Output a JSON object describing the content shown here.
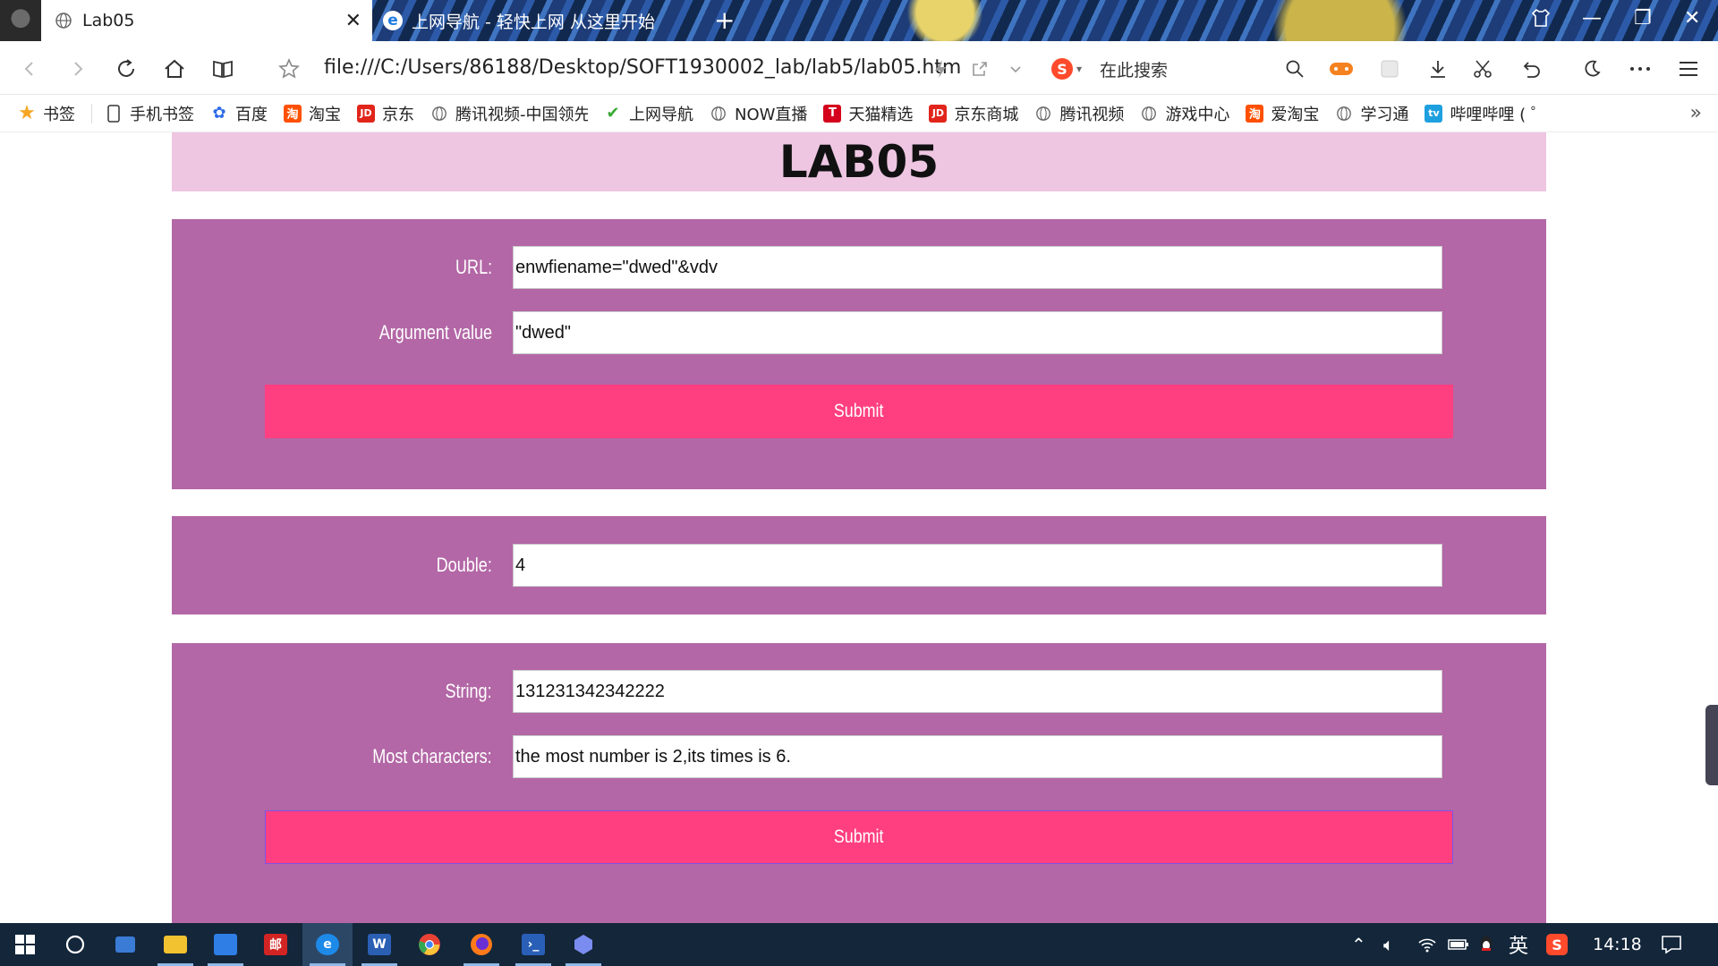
{
  "browser": {
    "tabs": [
      {
        "title": "Lab05",
        "active": true
      },
      {
        "title": "上网导航 - 轻快上网 从这里开始",
        "active": false
      }
    ],
    "url": "file:///C:/Users/86188/Desktop/SOFT1930002_lab/lab5/lab05.htm",
    "search_placeholder": "在此搜索",
    "bookmarks": [
      {
        "label": "书签",
        "icon": "star-icon"
      },
      {
        "label": "手机书签",
        "icon": "phone-icon"
      },
      {
        "label": "百度",
        "icon": "baidu-icon"
      },
      {
        "label": "淘宝",
        "icon": "taobao-icon"
      },
      {
        "label": "京东",
        "icon": "jd-icon"
      },
      {
        "label": "腾讯视频-中国领先",
        "icon": "globe-icon"
      },
      {
        "label": "上网导航",
        "icon": "hao-icon"
      },
      {
        "label": "NOW直播",
        "icon": "globe-icon"
      },
      {
        "label": "天猫精选",
        "icon": "tmall-icon"
      },
      {
        "label": "京东商城",
        "icon": "jd-icon"
      },
      {
        "label": "腾讯视频",
        "icon": "globe-icon"
      },
      {
        "label": "游戏中心",
        "icon": "globe-icon"
      },
      {
        "label": "爱淘宝",
        "icon": "taobao-icon"
      },
      {
        "label": "学习通",
        "icon": "globe-icon"
      },
      {
        "label": "哔哩哔哩 ( ゜- ゜)つ",
        "icon": "bilibili-icon"
      }
    ]
  },
  "page": {
    "title": "LAB05",
    "form1": {
      "url_label": "URL:",
      "url_value": "enwfiename=\"dwed\"&vdv",
      "arg_label": "Argument value",
      "arg_value": "\"dwed\"",
      "submit_label": "Submit"
    },
    "form2": {
      "double_label": "Double:",
      "double_value": "4"
    },
    "form3": {
      "string_label": "String:",
      "string_value": "131231342342222",
      "most_label": "Most characters:",
      "most_value": "the most number is 2,its times is 6.",
      "submit_label": "Submit"
    }
  },
  "taskbar": {
    "ime": "英",
    "clock": "14:18"
  },
  "colors": {
    "header_bg": "#eec6e2",
    "panel_bg": "#b367a6",
    "button_bg": "#ff3f80",
    "taskbar_bg": "#13263a"
  }
}
